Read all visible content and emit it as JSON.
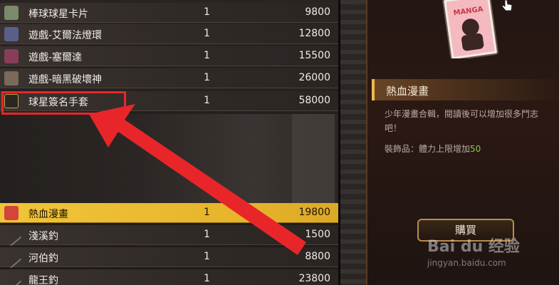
{
  "items": [
    {
      "name": "棒球球星卡片",
      "qty": "1",
      "price": "9800",
      "icon": "card-icon",
      "color": "#7a8a6a"
    },
    {
      "name": "遊戲-艾爾法燈環",
      "qty": "1",
      "price": "12800",
      "icon": "game-cartridge-icon",
      "color": "#5a5f8a"
    },
    {
      "name": "遊戲-塞爾達",
      "qty": "1",
      "price": "15500",
      "icon": "game-cartridge-icon",
      "color": "#8a3d5a"
    },
    {
      "name": "遊戲-暗黑破壞神",
      "qty": "1",
      "price": "26000",
      "icon": "game-cartridge-icon",
      "color": "#7a6a5a"
    },
    {
      "name": "球星簽名手套",
      "qty": "1",
      "price": "58000",
      "icon": "glove-icon",
      "color": "#2a2622"
    },
    {
      "name": "熱血漫畫",
      "qty": "1",
      "price": "19800",
      "icon": "manga-icon",
      "color": "#d5443a",
      "selected": true
    },
    {
      "name": "淺溪釣",
      "qty": "1",
      "price": "1500",
      "icon": "fishing-rod-icon",
      "color": "#5a5a5a"
    },
    {
      "name": "河伯釣",
      "qty": "1",
      "price": "8800",
      "icon": "fishing-rod-icon",
      "color": "#5a5a5a"
    },
    {
      "name": "龍王釣",
      "qty": "1",
      "price": "23800",
      "icon": "fishing-rod-icon",
      "color": "#5a5a5a"
    }
  ],
  "detail": {
    "title": "熱血漫畫",
    "description": "少年漫畫合輯，閱讀後可以增加很多鬥志吧！",
    "equip_label": "裝飾品：體力上限增加",
    "equip_value": "50",
    "buy_label": "購買"
  },
  "art": {
    "cover_text": "MANGA"
  },
  "watermark": {
    "logo": "Bai du 经验",
    "url": "jingyan.baidu.com"
  },
  "colors": {
    "highlight": "#f0c53a",
    "annotation": "#e8262a",
    "equip_value": "#7fd14a"
  }
}
